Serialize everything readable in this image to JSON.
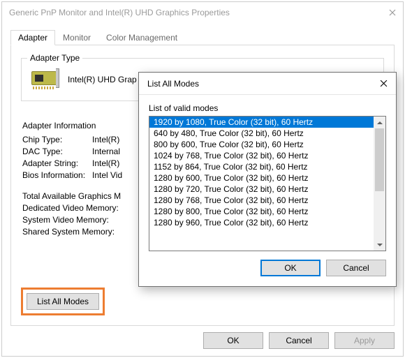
{
  "parent": {
    "title": "Generic PnP Monitor and Intel(R) UHD Graphics Properties",
    "tabs": [
      {
        "label": "Adapter",
        "active": true
      },
      {
        "label": "Monitor",
        "active": false
      },
      {
        "label": "Color Management",
        "active": false
      }
    ],
    "adapter_type": {
      "legend": "Adapter Type",
      "value": "Intel(R) UHD Grap"
    },
    "adapter_info": {
      "legend": "Adapter Information",
      "rows": [
        {
          "label": "Chip Type:",
          "value": "Intel(R)"
        },
        {
          "label": "DAC Type:",
          "value": "Internal"
        },
        {
          "label": "Adapter String:",
          "value": "Intel(R)"
        },
        {
          "label": "Bios Information:",
          "value": "Intel Vid"
        }
      ],
      "mem_rows": [
        {
          "label": "Total Available Graphics M"
        },
        {
          "label": "Dedicated Video Memory:"
        },
        {
          "label": "System Video Memory:"
        },
        {
          "label": "Shared System Memory:"
        }
      ]
    },
    "list_all_modes_label": "List All Modes",
    "actions": {
      "ok": "OK",
      "cancel": "Cancel",
      "apply": "Apply"
    }
  },
  "modal": {
    "title": "List All Modes",
    "list_label": "List of valid modes",
    "items": [
      "1920 by 1080, True Color (32 bit), 60 Hertz",
      "640 by 480, True Color (32 bit), 60 Hertz",
      "800 by 600, True Color (32 bit), 60 Hertz",
      "1024 by 768, True Color (32 bit), 60 Hertz",
      "1152 by 864, True Color (32 bit), 60 Hertz",
      "1280 by 600, True Color (32 bit), 60 Hertz",
      "1280 by 720, True Color (32 bit), 60 Hertz",
      "1280 by 768, True Color (32 bit), 60 Hertz",
      "1280 by 800, True Color (32 bit), 60 Hertz",
      "1280 by 960, True Color (32 bit), 60 Hertz"
    ],
    "selected_index": 0,
    "actions": {
      "ok": "OK",
      "cancel": "Cancel"
    }
  }
}
